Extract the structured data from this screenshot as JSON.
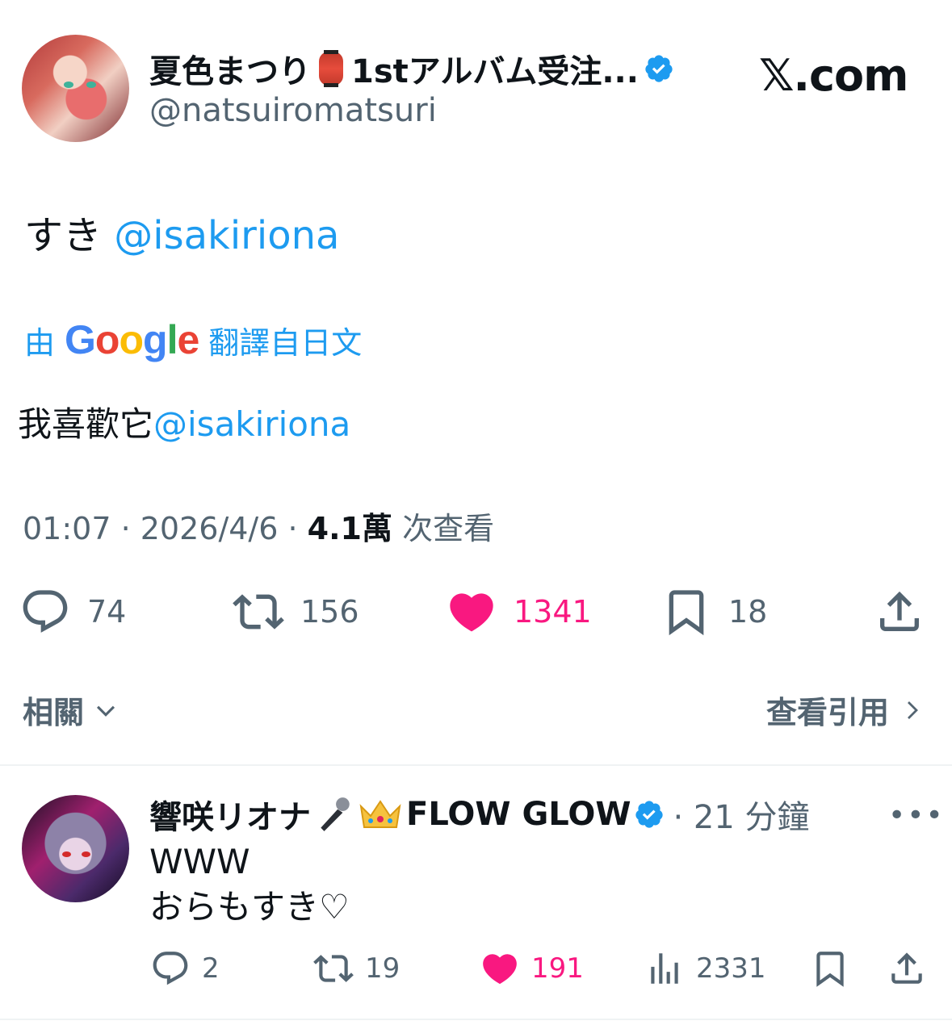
{
  "tweet": {
    "display_name": "夏色まつり",
    "display_name_suffix": "1stアルバム受注...",
    "handle": "@natsuiromatsuri",
    "site": "𝕏.com",
    "text_prefix": "すき ",
    "text_mention": "@isakiriona",
    "translate": {
      "prefix": "由",
      "brand": [
        "G",
        "o",
        "o",
        "g",
        "l",
        "e"
      ],
      "suffix": "翻譯自日文"
    },
    "translated_prefix": "我喜歡它",
    "translated_mention": "@isakiriona",
    "time": "01:07 · 2026/4/6 ·",
    "views_count": "4.1萬",
    "views_label": "次查看",
    "stats": {
      "replies": "74",
      "retweets": "156",
      "likes": "1341",
      "bookmarks": "18"
    },
    "related_label": "相關",
    "view_quotes_label": "查看引用"
  },
  "reply": {
    "display_name": "響咲リオナ",
    "display_name_suffix": "FLOW GLOW",
    "time": "· 21 分鐘",
    "more": "•••",
    "body": "WWW\nおらもすき♡",
    "stats": {
      "replies": "2",
      "retweets": "19",
      "likes": "191",
      "views": "2331"
    }
  },
  "colors": {
    "accent": "#1d9bf0",
    "like": "#f91880",
    "muted": "#536471",
    "text": "#0f1419"
  },
  "icons": [
    "verified-badge-icon",
    "lantern-emoji-icon",
    "reply-icon",
    "retweet-icon",
    "heart-icon",
    "bookmark-icon",
    "share-icon",
    "chevron-down-icon",
    "chevron-right-icon",
    "microphone-emoji-icon",
    "crown-emoji-icon",
    "views-icon",
    "more-icon"
  ]
}
